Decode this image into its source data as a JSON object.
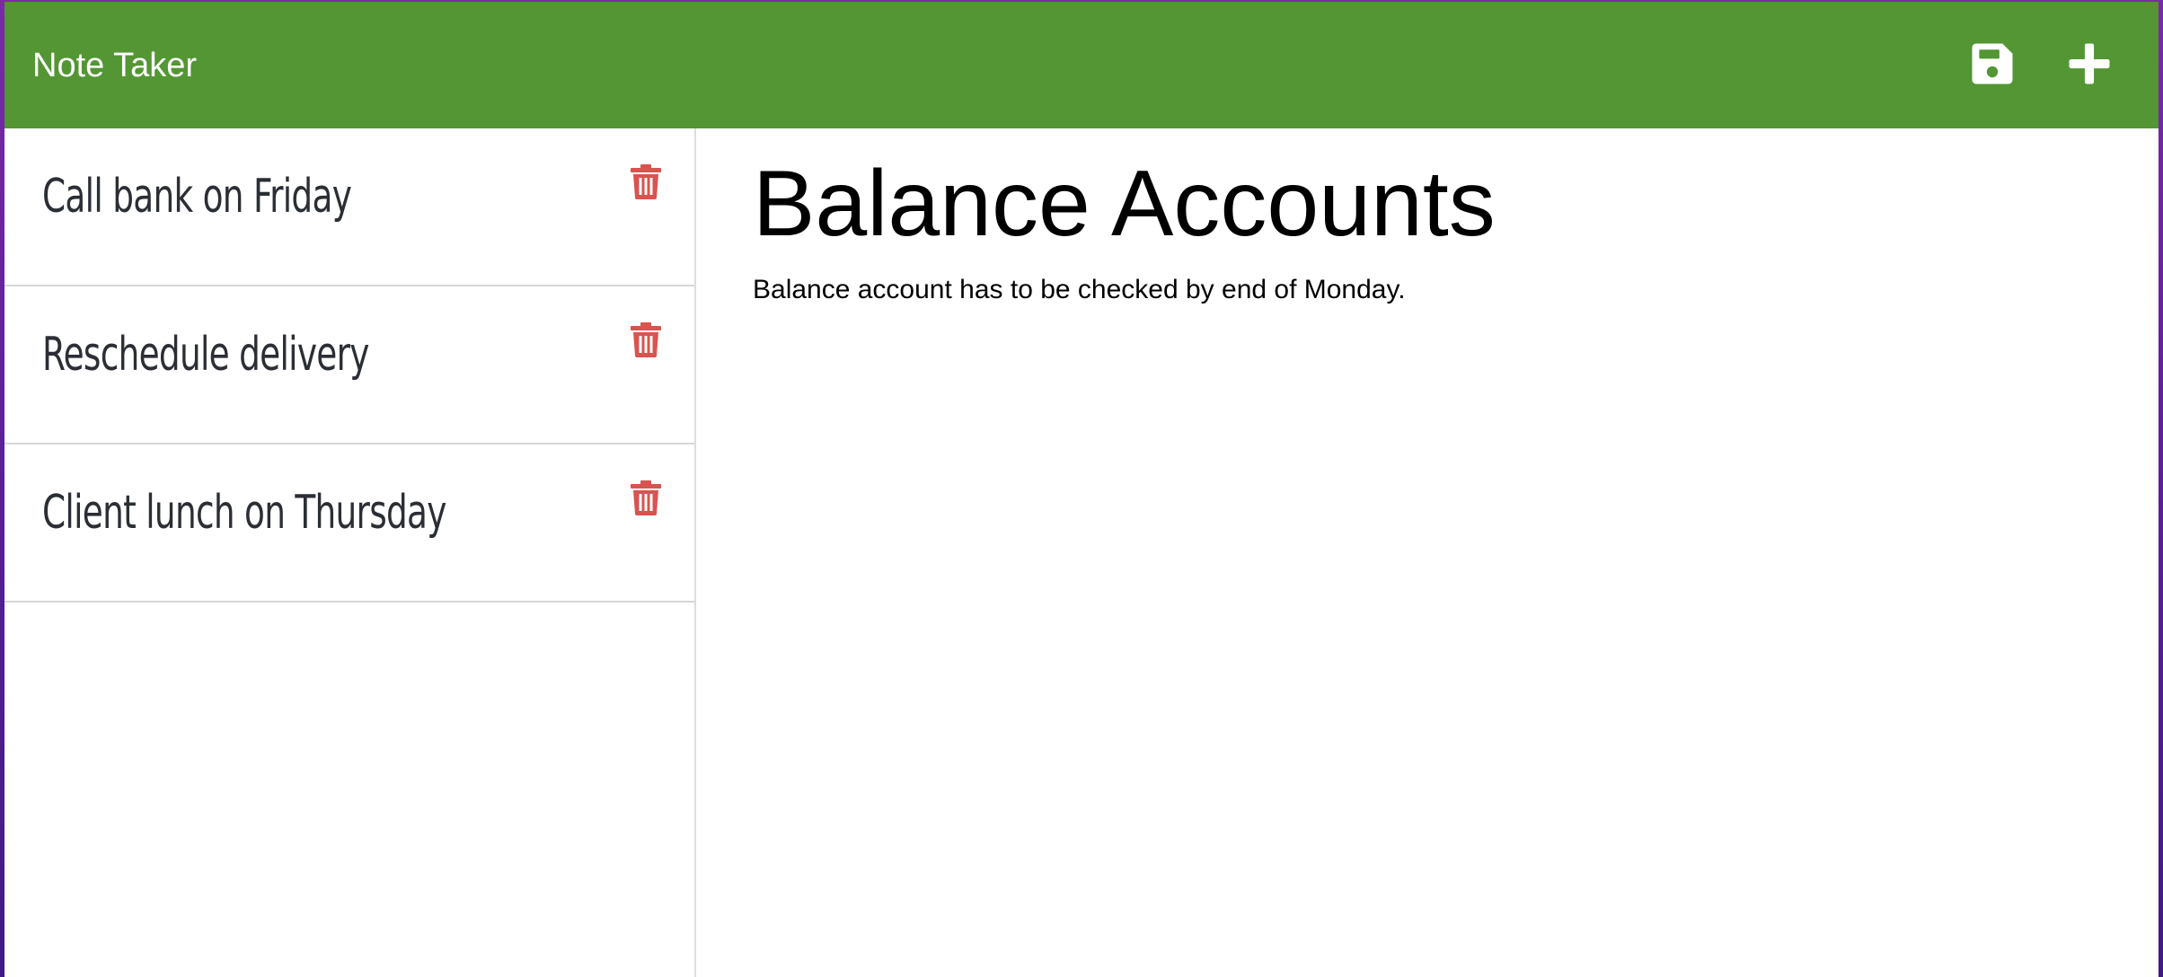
{
  "app": {
    "title": "Note Taker",
    "brand_color": "#539633",
    "accent_danger": "#d9534f"
  },
  "toolbar": {
    "save_icon": "save-icon",
    "add_icon": "plus-icon"
  },
  "notes": [
    {
      "title": "Call bank on Friday",
      "delete_icon": "trash-icon"
    },
    {
      "title": "Reschedule delivery",
      "delete_icon": "trash-icon"
    },
    {
      "title": "Client lunch on Thursday",
      "delete_icon": "trash-icon"
    }
  ],
  "active_note": {
    "title": "Balance Accounts",
    "text": "Balance account has to be checked by end of Monday."
  }
}
